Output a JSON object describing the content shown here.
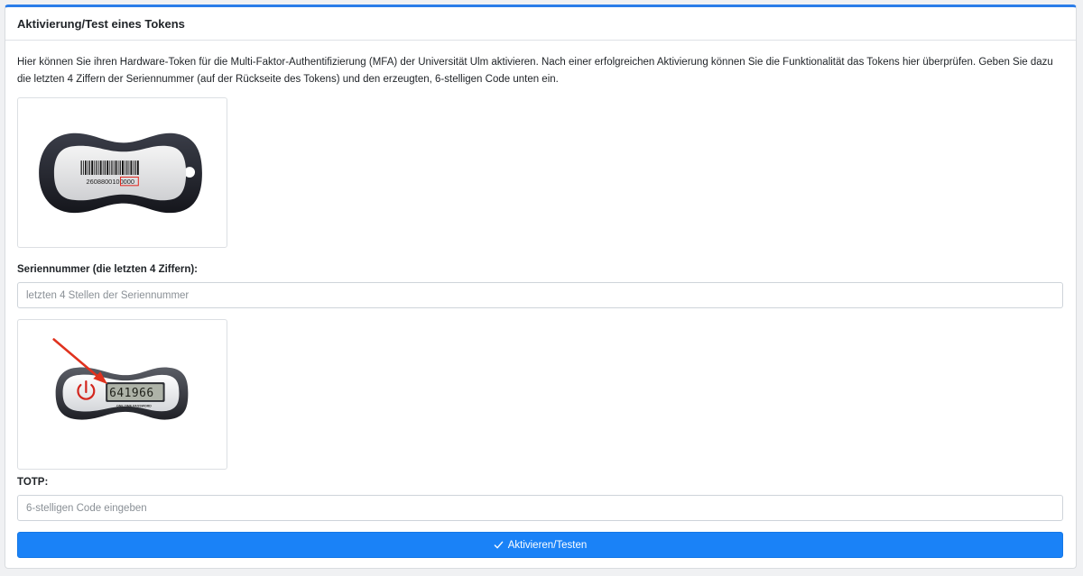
{
  "card": {
    "title": "Aktivierung/Test eines Tokens",
    "intro": "Hier können Sie ihren Hardware-Token für die Multi-Faktor-Authentifizierung (MFA) der Universität Ulm aktivieren. Nach einer erfolgreichen Aktivierung können Sie die Funktionalität das Tokens hier überprüfen. Geben Sie dazu die letzten 4 Ziffern der Seriennummer (auf der Rückseite des Tokens) und den erzeugten, 6-stelligen Code unten ein."
  },
  "serial_image": {
    "serial_prefix": "2608800",
    "serial_highlight": "0000",
    "serial_mid": "10",
    "icon": "token-back-image"
  },
  "serial_field": {
    "label": "Seriennummer (die letzten 4 Ziffern):",
    "placeholder": "letzten 4 Stellen der Seriennummer",
    "value": ""
  },
  "totp_image": {
    "display_code": "641966",
    "caption": "ONE TIME PASSWORD",
    "icon": "token-front-image"
  },
  "totp_field": {
    "label": "TOTP:",
    "placeholder": "6-stelligen Code eingeben",
    "value": ""
  },
  "submit": {
    "label": "Aktivieren/Testen",
    "icon": "check-icon"
  },
  "colors": {
    "accent": "#1a82f7",
    "header_border": "#2b7de9",
    "highlight_red": "#e0241b"
  }
}
